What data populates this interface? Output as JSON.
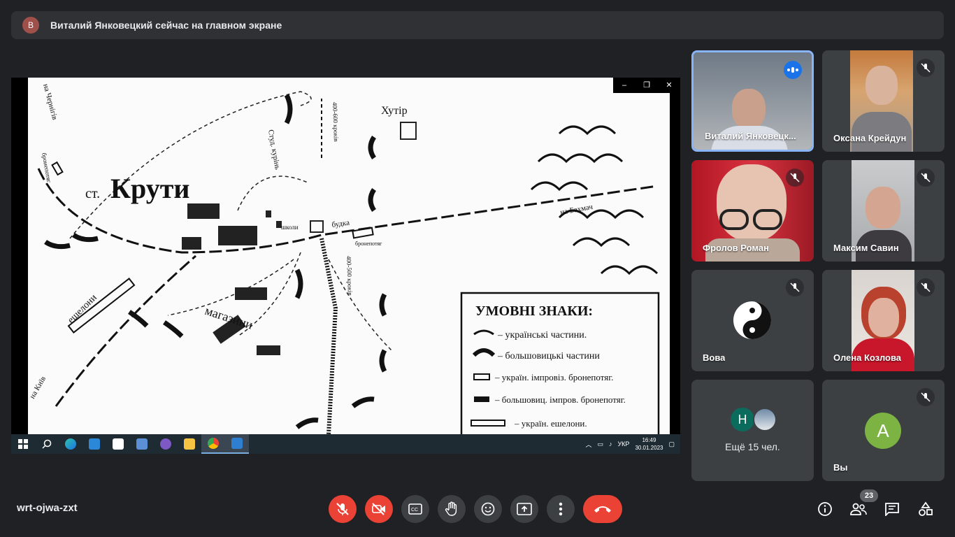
{
  "banner": {
    "avatar_letter": "В",
    "text": "Виталий Янковецкий сейчас на главном экране"
  },
  "shared_screen": {
    "map_labels": {
      "kruty": "Крути",
      "station": "ст.",
      "khutir": "Хутір",
      "budka": "будка",
      "shkoly": "школи",
      "na_bakhmach": "на Бахмач",
      "na_chernihiv": "на Чернігів",
      "na_kyiv": "на Київ",
      "eshelony": "ешелони",
      "mahazyny": "магазини",
      "studkurin": "Студ. курінь",
      "bronepotiah": "бронепотяг",
      "dist1": "400-600 кроків",
      "dist2": "400-500 кроків"
    },
    "legend": {
      "title": "УМОВНІ ЗНАКИ:",
      "items": [
        "– українські частини.",
        "– большовицькі частини",
        "– україн. імпровіз. бронепотяг.",
        "– большовиц. імпров. бронепотяг.",
        "– україн. ешелони."
      ]
    },
    "window_controls": {
      "min": "–",
      "max": "❐",
      "close": "✕"
    },
    "taskbar": {
      "lang": "УКР",
      "time": "16:49",
      "date": "30.01.2023"
    }
  },
  "participants": [
    {
      "name": "Виталий Янковецк...",
      "state": "speaking"
    },
    {
      "name": "Оксана Крейдун",
      "state": "muted"
    },
    {
      "name": "Фролов Роман",
      "state": "muted"
    },
    {
      "name": "Максим Савин",
      "state": "muted"
    },
    {
      "name": "Вова",
      "state": "muted"
    },
    {
      "name": "Олена Козлова",
      "state": "muted"
    }
  ],
  "more_tile": {
    "avatar_letter": "Н",
    "label": "Ещё 15 чел."
  },
  "self_tile": {
    "avatar_letter": "А",
    "label": "Вы"
  },
  "meeting_code": "wrt-ojwa-zxt",
  "participant_count": "23",
  "colors": {
    "bg": "#202124",
    "red": "#ea4335",
    "accent": "#1a73e8",
    "self_avatar": "#7cb342",
    "more_avatar": "#0b6b5c"
  }
}
